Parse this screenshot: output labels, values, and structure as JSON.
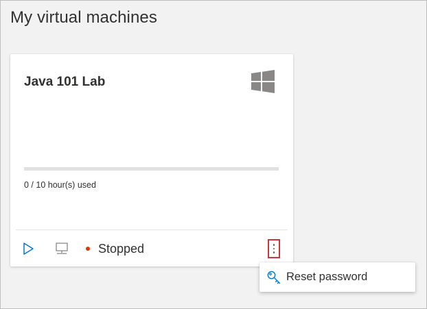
{
  "page": {
    "title": "My virtual machines"
  },
  "vm_card": {
    "name": "Java 101 Lab",
    "os_icon": "windows-logo-icon",
    "usage_text": "0 / 10 hour(s) used",
    "usage_fraction": 0.0,
    "status_text": "Stopped",
    "actions": {
      "start_icon": "play-icon",
      "connect_icon": "monitor-icon",
      "more_icon": "more-vertical-icon"
    }
  },
  "context_menu": {
    "items": [
      {
        "label": "Reset password",
        "icon": "key-icon"
      }
    ]
  },
  "colors": {
    "background": "#f2f2f2",
    "card": "#ffffff",
    "accent": "#0078d4",
    "status_stopped": "#d83b01",
    "icon_gray": "#8a8886",
    "highlight_border": "#d13438"
  }
}
